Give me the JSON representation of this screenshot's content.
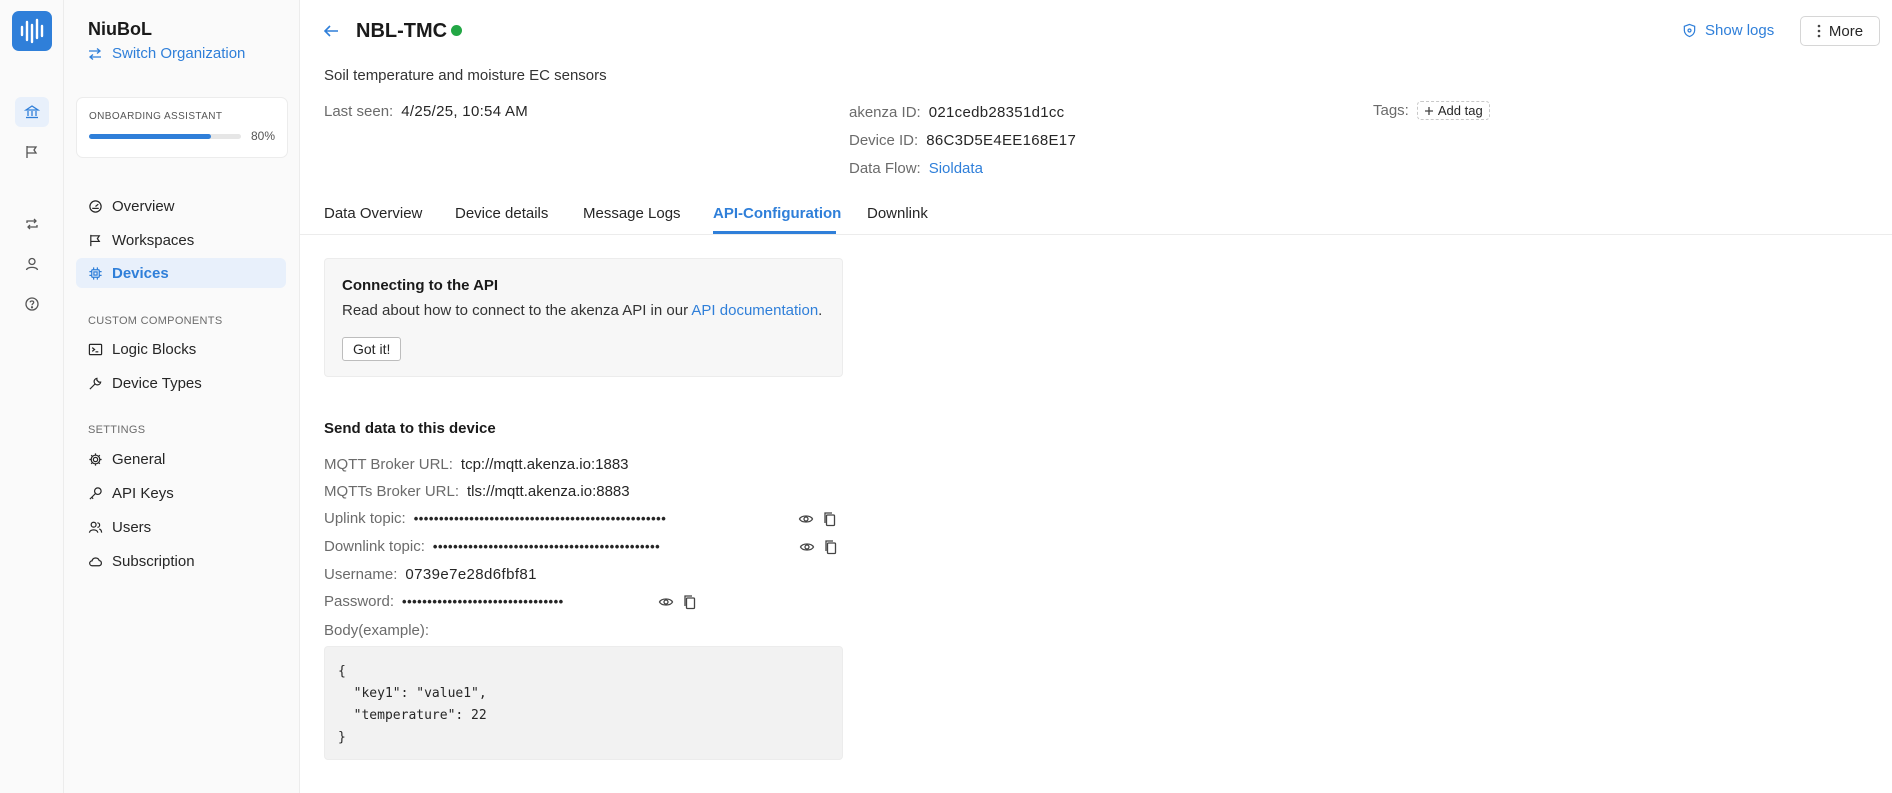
{
  "org": {
    "name": "NiuBoL",
    "switch_label": "Switch Organization"
  },
  "onboarding": {
    "title": "ONBOARDING ASSISTANT",
    "progress_label": "80%",
    "progress": 0.8
  },
  "nav": {
    "main": [
      {
        "label": "Overview",
        "icon": "dashboard-icon"
      },
      {
        "label": "Workspaces",
        "icon": "flag-icon"
      },
      {
        "label": "Devices",
        "icon": "chip-icon",
        "active": true
      }
    ],
    "custom_label": "CUSTOM COMPONENTS",
    "custom": [
      {
        "label": "Logic Blocks",
        "icon": "terminal-icon"
      },
      {
        "label": "Device Types",
        "icon": "wrench-icon"
      }
    ],
    "settings_label": "SETTINGS",
    "settings": [
      {
        "label": "General",
        "icon": "gear-icon"
      },
      {
        "label": "API Keys",
        "icon": "key-icon"
      },
      {
        "label": "Users",
        "icon": "users-icon"
      },
      {
        "label": "Subscription",
        "icon": "cloud-icon"
      }
    ]
  },
  "header": {
    "device_name": "NBL-TMC",
    "status_color": "#23a745",
    "show_logs": "Show logs",
    "more": "More",
    "description": "Soil temperature and moisture EC sensors"
  },
  "meta": {
    "last_seen_label": "Last seen:",
    "last_seen": "4/25/25, 10:54 AM",
    "akenza_id_label": "akenza ID:",
    "akenza_id": "021cedb28351d1cc",
    "device_id_label": "Device ID:",
    "device_id": "86C3D5E4EE168E17",
    "data_flow_label": "Data Flow:",
    "data_flow": "Sioldata",
    "tags_label": "Tags:",
    "add_tag": "Add tag"
  },
  "tabs": [
    "Data Overview",
    "Device details",
    "Message Logs",
    "API-Configuration",
    "Downlink"
  ],
  "active_tab": "API-Configuration",
  "info_card": {
    "title": "Connecting to the API",
    "text": "Read about how to connect to the akenza API in our ",
    "link": "API documentation",
    "period": ".",
    "button": "Got it!"
  },
  "send": {
    "title": "Send data to this device",
    "mqtt_label": "MQTT Broker URL:",
    "mqtt_url": "tcp://mqtt.akenza.io:1883",
    "mqtts_label": "MQTTs Broker URL:",
    "mqtts_url": "tls://mqtt.akenza.io:8883",
    "uplink_label": "Uplink topic:",
    "uplink_masked": "••••••••••••••••••••••••••••••••••••••••••••••••••",
    "downlink_label": "Downlink topic:",
    "downlink_masked": "•••••••••••••••••••••••••••••••••••••••••••••",
    "username_label": "Username:",
    "username": "0739e7e28d6fbf81",
    "password_label": "Password:",
    "password_masked": "••••••••••••••••••••••••••••••••",
    "body_label": "Body(example):",
    "body": "{\n  \"key1\": \"value1\",\n  \"temperature\": 22\n}"
  },
  "colors": {
    "accent": "#2f7fd9",
    "status_online": "#23a745"
  }
}
